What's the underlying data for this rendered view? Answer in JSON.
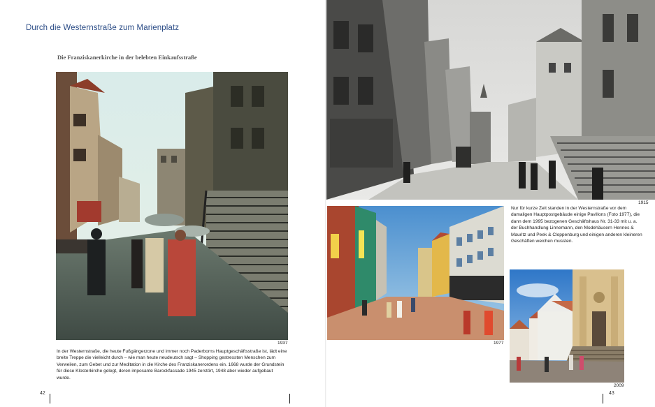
{
  "left_page": {
    "chapter_title": "Durch die Westernstraße zum Marienplatz",
    "subtitle": "Die Franziskanerkirche in der belebten Einkaufsstraße",
    "photo_main": {
      "year": "1937"
    },
    "caption": "In der Westernstraße, die heute Fußgängerzone und immer noch Paderborns Hauptgeschäftsstraße ist, lädt eine breite Treppe die vielleicht durch – wie man heute neudeutsch sagt – Shopping gestressten Menschen zum Verweilen, zum Gebet und zur Meditation in die Kirche des Franziskanerordens ein. 1668 wurde der Grundstein für diese Klosterkirche gelegt, deren imposante Barockfassade 1945 zerstört, 1948 aber wieder aufgebaut wurde.",
    "page_number": "42"
  },
  "right_page": {
    "photo_top": {
      "year": "1915"
    },
    "photo_mid": {
      "year": "1977"
    },
    "photo_small": {
      "year": "2009"
    },
    "caption": "Nur für kurze Zeit standen in der Westernstraße vor dem damaligen Hauptpostgebäude einige Pavillons (Foto 1977), die dann dem 1995 bezogenen Geschäftshaus Nr. 31-33 mit u. a. der Buchhandlung Linnemann, den Modehäusern Hennes & Mauritz und Peek & Cloppenburg und einigen anderen kleineren Geschäften weichen mussten.",
    "page_number": "43"
  }
}
